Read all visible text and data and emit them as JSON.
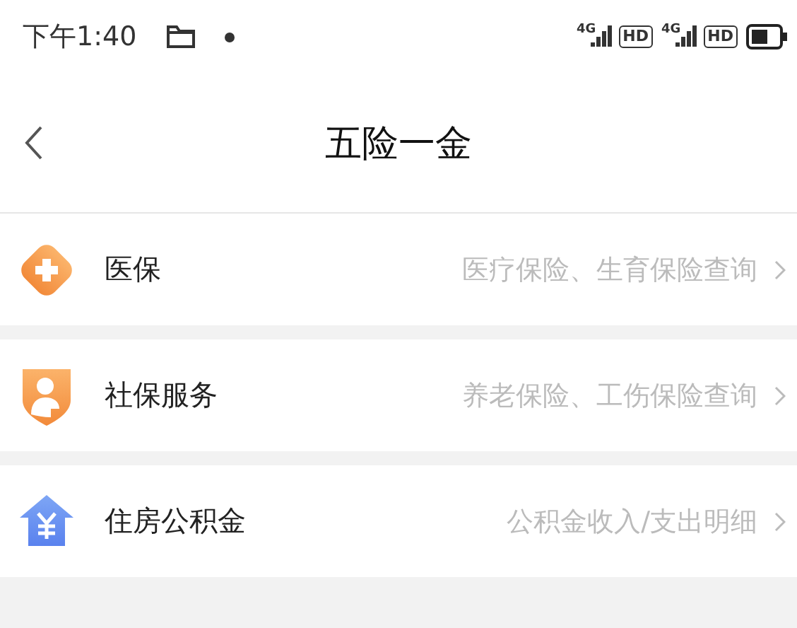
{
  "status_bar": {
    "time": "下午1:40",
    "signals": [
      "4G",
      "4G"
    ],
    "hd": [
      "HD",
      "HD"
    ]
  },
  "header": {
    "title": "五险一金"
  },
  "items": [
    {
      "kind": "medical",
      "label": "医保",
      "detail": "医疗保险、生育保险查询"
    },
    {
      "kind": "social",
      "label": "社保服务",
      "detail": "养老保险、工伤保险查询"
    },
    {
      "kind": "fund",
      "label": "住房公积金",
      "detail": "公积金收入/支出明细"
    }
  ]
}
